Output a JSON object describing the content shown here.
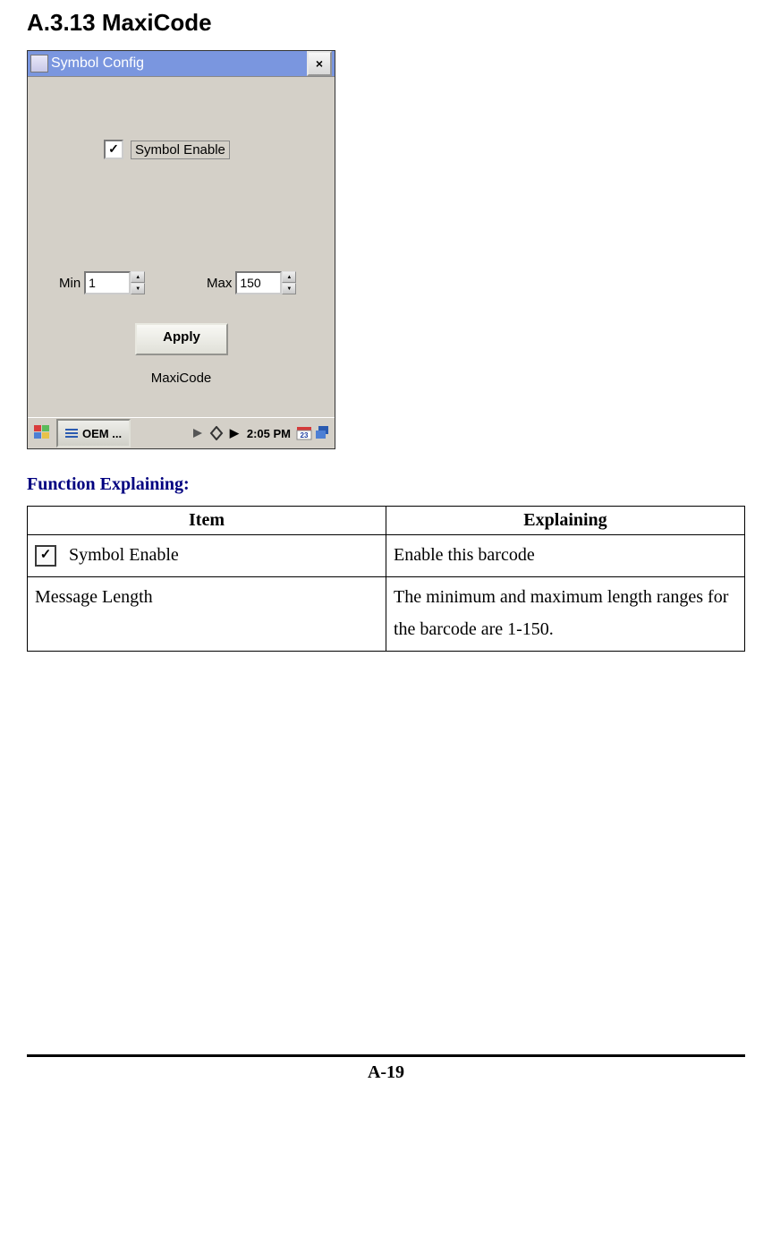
{
  "section_heading": "A.3.13 MaxiCode",
  "dialog": {
    "title": "Symbol Config",
    "close_label": "×",
    "checkbox_checked": "✓",
    "checkbox_label": "Symbol Enable",
    "min_label": "Min",
    "min_value": "1",
    "max_label": "Max",
    "max_value": "150",
    "apply_label": "Apply",
    "barcode_name": "MaxiCode"
  },
  "taskbar": {
    "app_label": "OEM ...",
    "time": "2:05 PM",
    "arrow": "▶"
  },
  "subhead": "Function Explaining:",
  "table": {
    "headers": {
      "item": "Item",
      "explaining": "Explaining"
    },
    "rows": [
      {
        "has_checkbox": true,
        "check_mark": "✓",
        "item": "Symbol Enable",
        "explaining": "Enable this barcode"
      },
      {
        "item": " Message Length",
        "explaining": "The minimum and maximum length ranges for the barcode are 1-150."
      }
    ]
  },
  "page_number": "A-19"
}
